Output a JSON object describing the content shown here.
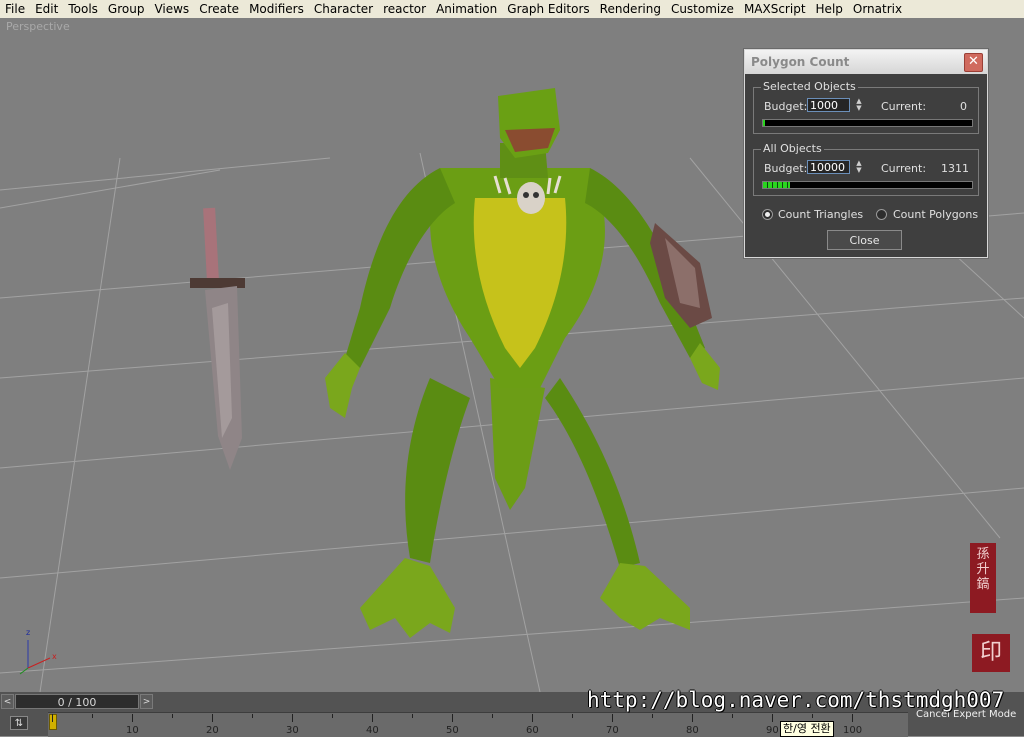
{
  "menu": {
    "items": [
      "File",
      "Edit",
      "Tools",
      "Group",
      "Views",
      "Create",
      "Modifiers",
      "Character",
      "reactor",
      "Animation",
      "Graph Editors",
      "Rendering",
      "Customize",
      "MAXScript",
      "Help",
      "Ornatrix"
    ]
  },
  "viewport": {
    "label": "Perspective",
    "axis_z": "z",
    "axis_x": "x"
  },
  "polygon_count": {
    "title": "Polygon Count",
    "close_x": "✕",
    "selected": {
      "label": "Selected Objects",
      "budget_label": "Budget:",
      "budget_value": "1000",
      "current_label": "Current:",
      "current_value": "0",
      "progress": 0.01
    },
    "all": {
      "label": "All Objects",
      "budget_label": "Budget:",
      "budget_value": "10000",
      "current_label": "Current:",
      "current_value": "1311",
      "progress": 0.13
    },
    "count_triangles": "Count Triangles",
    "count_polygons": "Count Polygons",
    "mode_selected": "triangles",
    "close_button": "Close"
  },
  "timeline": {
    "frame_display": "0 / 100",
    "prev_arrow": "<",
    "next_arrow": ">",
    "ticks": [
      "10",
      "20",
      "30",
      "40",
      "50",
      "60",
      "70",
      "80",
      "90",
      "100"
    ],
    "cancel_expert": "Cancel Expert Mode",
    "ime_tooltip": "한/영 전환"
  },
  "watermark": "http://blog.naver.com/thstmdgh007",
  "seal": {
    "top_text": "孫升鎬",
    "bottom_text": "印"
  },
  "colors": {
    "viewport_bg": "#7f7f7f",
    "progress_green": "#2ad51f",
    "seal_red": "#8d1a22",
    "creature_green": "#5f8f15"
  }
}
